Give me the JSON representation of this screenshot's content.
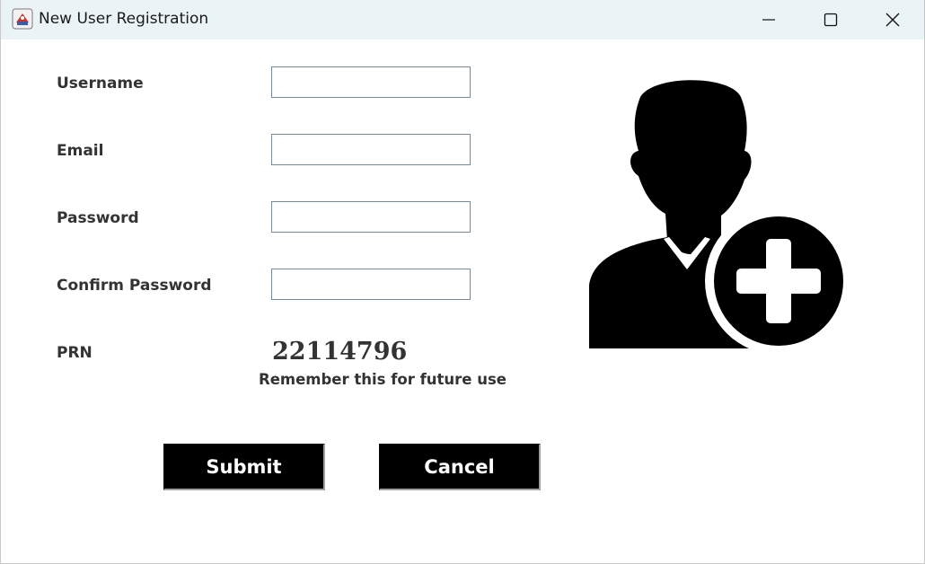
{
  "window": {
    "title": "New User Registration",
    "icons": {
      "app": "java-app-icon",
      "minimize": "minimize-icon",
      "maximize": "maximize-icon",
      "close": "close-icon"
    }
  },
  "form": {
    "username": {
      "label": "Username",
      "value": ""
    },
    "email": {
      "label": "Email",
      "value": ""
    },
    "password": {
      "label": "Password",
      "value": ""
    },
    "confirm_password": {
      "label": "Confirm Password",
      "value": ""
    },
    "prn": {
      "label": "PRN",
      "value": "22114796",
      "note": "Remember this for future use"
    }
  },
  "actions": {
    "submit_label": "Submit",
    "cancel_label": "Cancel"
  },
  "illustration": {
    "icon": "add-user-icon"
  },
  "colors": {
    "titlebar_bg": "#eaf3f5",
    "button_bg": "#000000",
    "button_text": "#ffffff",
    "label_text": "#333333"
  }
}
